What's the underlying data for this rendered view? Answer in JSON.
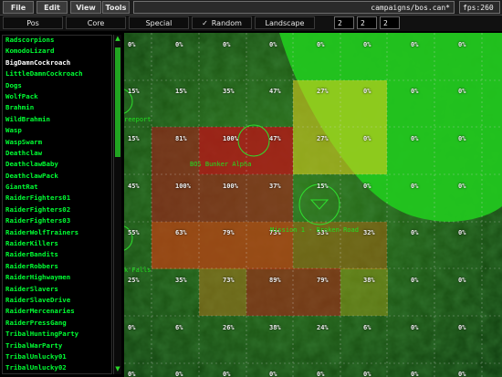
{
  "menu": {
    "file": "File",
    "edit": "Edit",
    "view": "View",
    "tools": "Tools"
  },
  "path": "campaigns/bos.can*",
  "fps": "fps:260",
  "toolbar": {
    "pos": "Pos",
    "core": "Core",
    "special": "Special",
    "random_check": "✓",
    "random": "Random",
    "landscape": "Landscape",
    "n1": "2",
    "n2": "2",
    "n3": "2"
  },
  "encounters": [
    "Radscorpions",
    "KomodoLizard",
    "BigDamnCockroach",
    "LittleDamnCockroach",
    "Dogs",
    "WolfPack",
    "Brahmin",
    "WildBrahmin",
    "Wasp",
    "WaspSwarm",
    "Deathclaw",
    "DeathclawBaby",
    "DeathclawPack",
    "GiantRat",
    "RaiderFighters01",
    "RaiderFighters02",
    "RaiderFighters03",
    "RaiderWolfTrainers",
    "RaiderKillers",
    "RaiderBandits",
    "RaiderRobbers",
    "RaiderHighwaymen",
    "RaiderSlavers",
    "RaiderSlaveDrive",
    "RaiderMercenaries",
    "RaiderPressGang",
    "TribalHuntingParty",
    "TribalWarParty",
    "TribalUnlucky01",
    "TribalUnlucky02"
  ],
  "selected_index": 2,
  "grid": [
    [
      "0%",
      "0%",
      "0%",
      "0%",
      "0%",
      "0%",
      "0%",
      "0%"
    ],
    [
      "15%",
      "15%",
      "35%",
      "47%",
      "27%",
      "0%",
      "0%",
      "0%"
    ],
    [
      "15%",
      "81%",
      "100%",
      "47%",
      "27%",
      "0%",
      "0%",
      "0%"
    ],
    [
      "45%",
      "100%",
      "100%",
      "37%",
      "15%",
      "0%",
      "0%",
      "0%"
    ],
    [
      "55%",
      "63%",
      "79%",
      "73%",
      "53%",
      "32%",
      "0%",
      "0%"
    ],
    [
      "25%",
      "35%",
      "73%",
      "89%",
      "79%",
      "38%",
      "0%",
      "0%"
    ],
    [
      "0%",
      "6%",
      "26%",
      "38%",
      "24%",
      "6%",
      "0%",
      "0%"
    ],
    [
      "0%",
      "0%",
      "0%",
      "0%",
      "0%",
      "0%",
      "0%",
      "0%"
    ]
  ],
  "labels": {
    "bunker": "BOS Bunker Alpha",
    "mission": "Mission 1 - Broken Road",
    "freeport": "reeport",
    "falls": "k Falls"
  },
  "colors": {
    "accent": "#00ff33",
    "selected": "#ffffff",
    "hot": "#c4101a",
    "warm": "#d8a01a",
    "cool": "#1a9a1a"
  }
}
